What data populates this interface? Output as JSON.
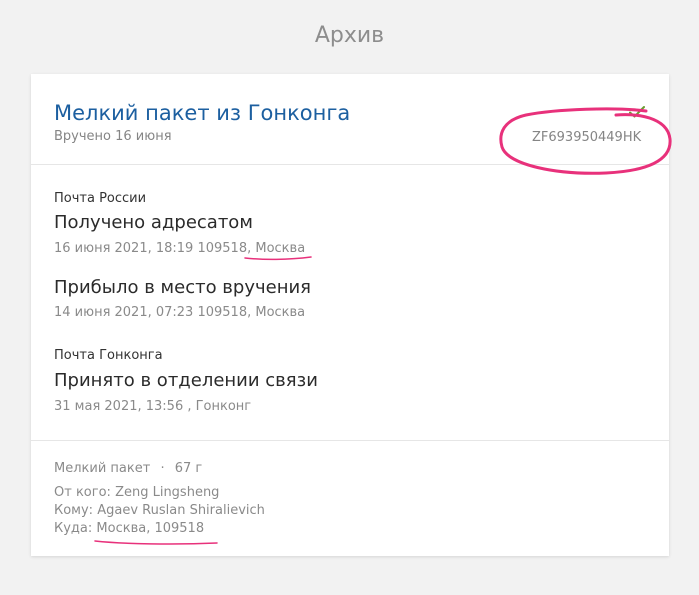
{
  "page": {
    "title": "Архив"
  },
  "parcel": {
    "title": "Мелкий пакет из Гонконга",
    "delivered": "Вручено 16 июня",
    "tracking_number": "ZF693950449HK"
  },
  "events": [
    {
      "carrier": "Почта России",
      "status": "Получено адресатом",
      "meta_prefix": "16 июня 2021, 18:19 109518, ",
      "meta_city": "Москва"
    },
    {
      "status": "Прибыло в место вручения",
      "meta": "14 июня 2021, 07:23 109518, Москва"
    },
    {
      "carrier": "Почта Гонконга",
      "status": "Принято в отделении связи",
      "meta": "31 мая 2021, 13:56 , Гонконг"
    }
  ],
  "details": {
    "type": "Мелкий пакет",
    "separator": "·",
    "weight": "67 г",
    "from_label": "От кого:",
    "from_value": "Zeng Lingsheng",
    "to_label": "Кому:",
    "to_value": "Agaev Ruslan Shiralievich",
    "dest_label": "Куда:",
    "dest_value": "Москва, 109518"
  },
  "colors": {
    "accent": "#1c5fa0",
    "check": "#6a9a2e",
    "annotation": "#e8317b"
  },
  "icons": {
    "status": "check-icon"
  }
}
